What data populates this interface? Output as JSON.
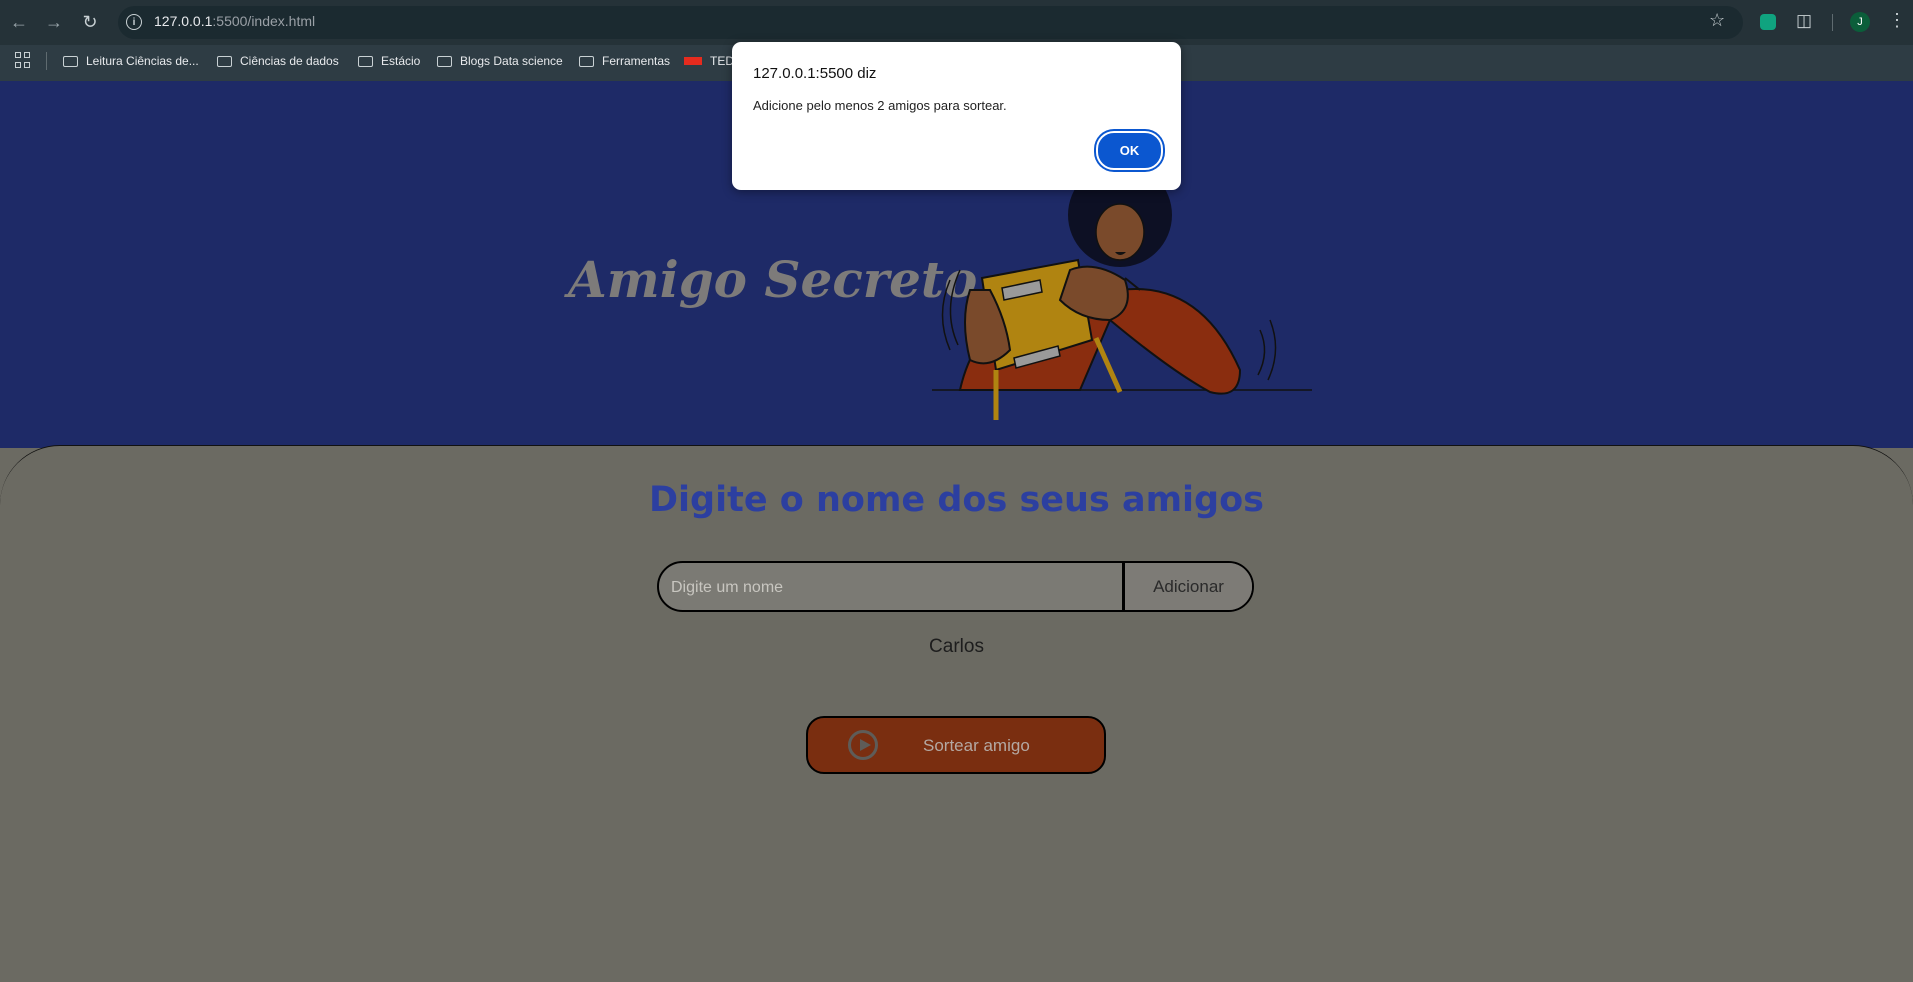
{
  "browser": {
    "url_host": "127.0.0.1",
    "url_rest": ":5500/index.html",
    "avatar_letter": "J",
    "bookmarks": [
      {
        "label": "Leitura Ciências de..."
      },
      {
        "label": "Ciências de dados"
      },
      {
        "label": "Estácio"
      },
      {
        "label": "Blogs Data science"
      },
      {
        "label": "Ferramentas"
      },
      {
        "label": "TED:"
      }
    ]
  },
  "page": {
    "title": "Amigo Secreto",
    "section_title": "Digite o nome dos seus amigos",
    "input_placeholder": "Digite um nome",
    "add_button": "Adicionar",
    "friends": [
      "Carlos"
    ],
    "draw_button": "Sortear amigo"
  },
  "dialog": {
    "title": "127.0.0.1:5500 diz",
    "message": "Adicione pelo menos 2 amigos para sortear.",
    "ok_label": "OK"
  },
  "colors": {
    "hero_bg": "#1e2a67",
    "content_bg": "#6b6a62",
    "section_title": "#2c3fa0",
    "draw_button": "#7a2e10",
    "dialog_ok": "#0b57d0"
  }
}
